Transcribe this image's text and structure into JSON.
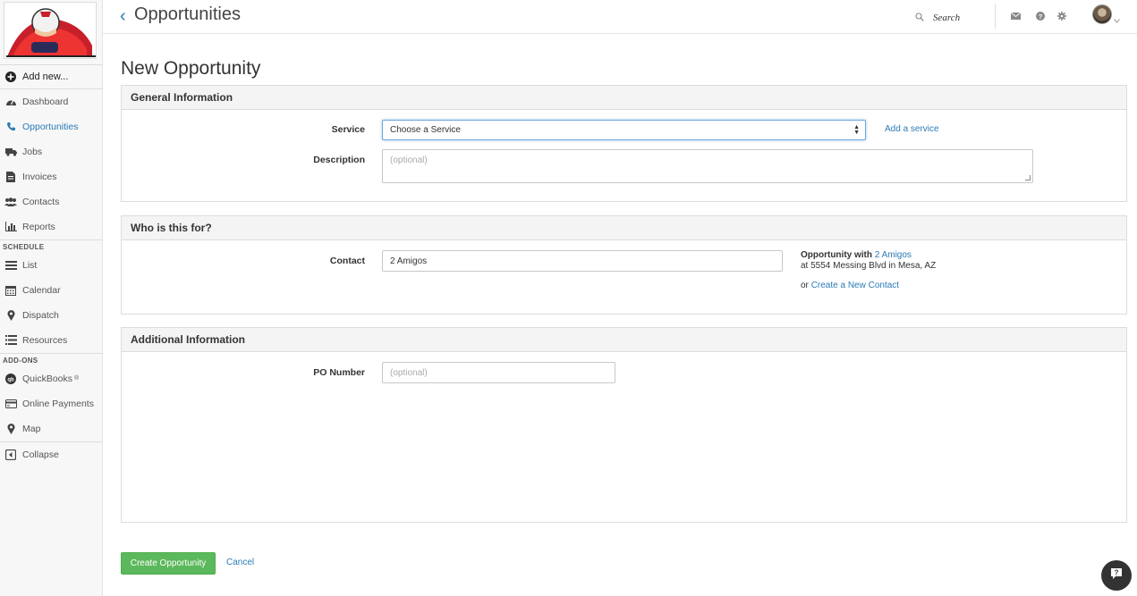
{
  "sidebar": {
    "add_new": "Add new...",
    "items": [
      {
        "label": "Dashboard",
        "icon": "dashboard-icon"
      },
      {
        "label": "Opportunities",
        "icon": "phone-icon",
        "active": true
      },
      {
        "label": "Jobs",
        "icon": "truck-icon"
      },
      {
        "label": "Invoices",
        "icon": "invoice-icon"
      },
      {
        "label": "Contacts",
        "icon": "contacts-icon"
      },
      {
        "label": "Reports",
        "icon": "bar-chart-icon"
      }
    ],
    "schedule_heading": "SCHEDULE",
    "schedule_items": [
      {
        "label": "List",
        "icon": "list-icon"
      },
      {
        "label": "Calendar",
        "icon": "calendar-icon"
      },
      {
        "label": "Dispatch",
        "icon": "map-pin-icon"
      },
      {
        "label": "Resources",
        "icon": "resources-icon"
      }
    ],
    "addons_heading": "ADD-ONS",
    "addon_items": [
      {
        "label": "QuickBooks",
        "icon": "quickbooks-icon",
        "sup": "®"
      },
      {
        "label": "Online Payments",
        "icon": "credit-card-icon"
      },
      {
        "label": "Map",
        "icon": "map-pin-icon"
      }
    ],
    "collapse": "Collapse"
  },
  "header": {
    "back_glyph": "‹",
    "title": "Opportunities",
    "search_label": "Search"
  },
  "page": {
    "heading": "New Opportunity"
  },
  "general": {
    "title": "General Information",
    "service_label": "Service",
    "service_value": "Choose a Service",
    "add_service": "Add a service",
    "description_label": "Description",
    "description_placeholder": "(optional)"
  },
  "who": {
    "title": "Who is this for?",
    "contact_label": "Contact",
    "contact_value": "2 Amigos",
    "opportunity_with": "Opportunity with",
    "contact_link": "2 Amigos",
    "address": "at 5554 Messing Blvd in Mesa, AZ",
    "or": "or",
    "create_contact": "Create a New Contact"
  },
  "additional": {
    "title": "Additional Information",
    "po_label": "PO Number",
    "po_placeholder": "(optional)"
  },
  "actions": {
    "create": "Create Opportunity",
    "cancel": "Cancel"
  },
  "colors": {
    "accent": "#2a7bb6",
    "primary_button": "#5cb85c"
  }
}
